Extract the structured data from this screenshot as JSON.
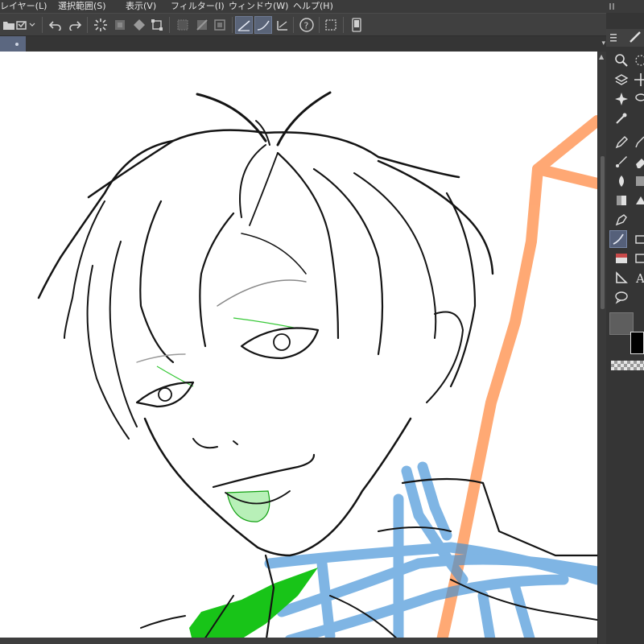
{
  "menu": {
    "items": [
      {
        "label": "レイヤー(L)"
      },
      {
        "label": "選択範囲(S)"
      },
      {
        "label": "表示(V)"
      },
      {
        "label": "フィルター(I)"
      },
      {
        "label": "ウィンドウ(W)"
      },
      {
        "label": "ヘルプ(H)"
      }
    ]
  },
  "toolbar": {
    "buttons": [
      {
        "icon": "open-folder-icon"
      },
      {
        "icon": "save-icon"
      },
      {
        "icon": "undo-icon"
      },
      {
        "icon": "redo-icon"
      },
      {
        "icon": "loading-spinner-icon"
      },
      {
        "icon": "clear-icon"
      },
      {
        "icon": "fill-icon"
      },
      {
        "icon": "transform-icon"
      },
      {
        "icon": "deselect-icon"
      },
      {
        "icon": "invert-selection-icon"
      },
      {
        "icon": "show-selection-icon"
      },
      {
        "icon": "stabilization-icon"
      },
      {
        "icon": "snap-ruler-icon"
      },
      {
        "icon": "snap-special-ruler-icon"
      },
      {
        "icon": "help-icon"
      },
      {
        "icon": "selection-launcher-icon"
      },
      {
        "icon": "device-icon"
      }
    ]
  },
  "palette": {
    "tools": [
      {
        "icon": "zoom-icon"
      },
      {
        "icon": "move-icon"
      },
      {
        "icon": "layer-move-icon"
      },
      {
        "icon": "auto-select-icon"
      },
      {
        "icon": "eyedropper-icon"
      },
      {
        "icon": "pen-icon"
      },
      {
        "icon": "pencil-icon"
      },
      {
        "icon": "brush-icon"
      },
      {
        "icon": "eraser-icon"
      },
      {
        "icon": "blend-icon"
      },
      {
        "icon": "gradient-icon"
      },
      {
        "icon": "fill-bucket-icon"
      },
      {
        "icon": "figure-icon"
      },
      {
        "icon": "text-icon"
      },
      {
        "icon": "balloon-icon"
      },
      {
        "icon": "frame-border-icon"
      },
      {
        "icon": "ruler-icon"
      }
    ]
  },
  "colors": {
    "line_art": "#141414",
    "green_layer": "#18c418",
    "blue_sketch": "#3b8fd6",
    "orange_sketch": "#ff9a5c",
    "canvas_bg": "#ffffff",
    "active_tool": "#55607a"
  }
}
